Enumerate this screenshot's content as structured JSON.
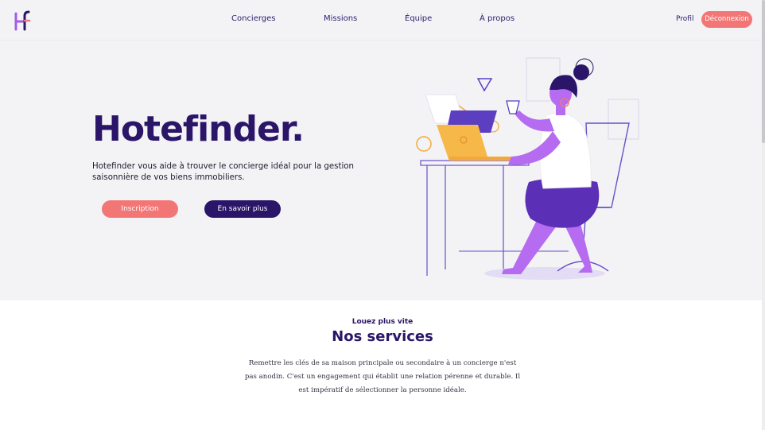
{
  "nav": {
    "logo_icon": "hotefinder-logo-icon",
    "links": [
      {
        "label": "Concierges"
      },
      {
        "label": "Missions"
      },
      {
        "label": "Équipe"
      },
      {
        "label": "À propos"
      }
    ],
    "profile_label": "Profil",
    "logout_label": "Déconnexion"
  },
  "hero": {
    "title": "Hotefinder.",
    "description": "Hotefinder vous aide à trouver le concierge idéal pour la gestion saisonnière de vos biens immobiliers.",
    "signup_label": "Inscription",
    "learn_more_label": "En savoir plus",
    "illustration_icon": "woman-working-at-laptop-illustration"
  },
  "services": {
    "kicker": "Louez plus vite",
    "title": "Nos services",
    "text": "Remettre les clés de sa maison principale ou secondaire à un concierge n'est pas anodin. C'est un engagement qui établit une relation pérenne et durable. Il est impératif de sélectionner la personne idéale."
  },
  "colors": {
    "primary": "#2b1568",
    "accent": "#f37676",
    "purple": "#a35ee8",
    "hero_background": "#f3f3f6"
  }
}
